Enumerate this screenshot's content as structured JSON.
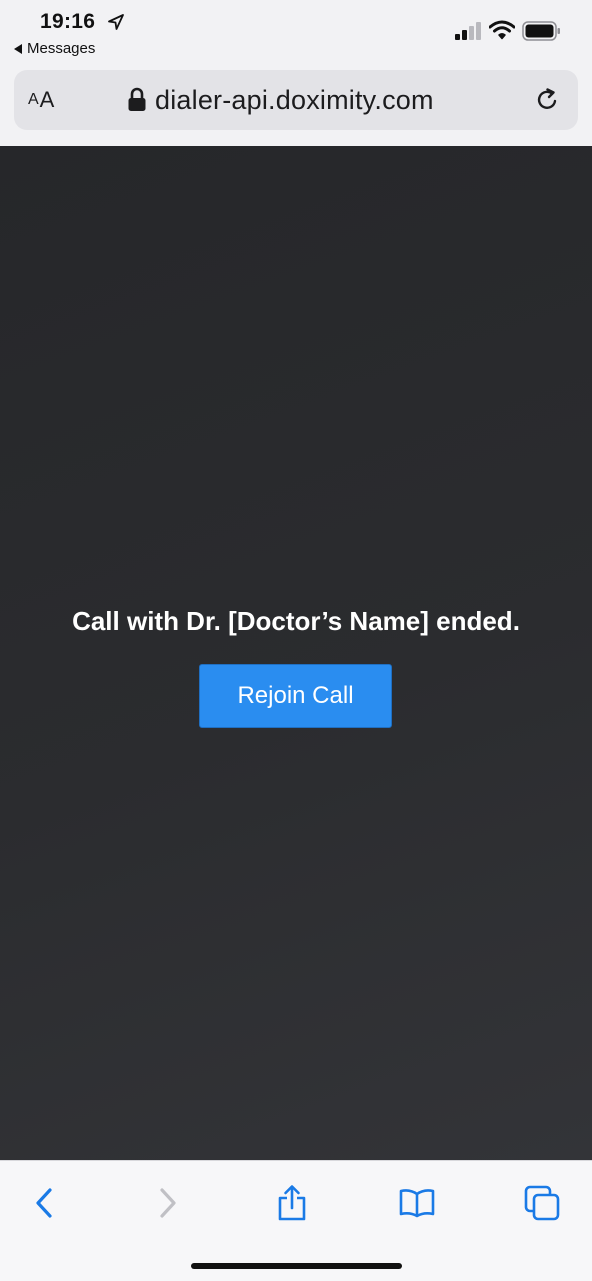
{
  "status_bar": {
    "time": "19:16",
    "back_app_label": "Messages"
  },
  "browser": {
    "text_size_small": "A",
    "text_size_large": "A",
    "url": "dialer-api.doximity.com"
  },
  "call": {
    "ended_message": "Call with Dr. [Doctor’s Name] ended.",
    "rejoin_label": "Rejoin Call",
    "button_color": "#2a8df0"
  },
  "toolbar": {
    "items": [
      "back-icon",
      "forward-icon",
      "share-icon",
      "bookmarks-icon",
      "tabs-icon"
    ],
    "accent_color": "#1a7ae6"
  }
}
